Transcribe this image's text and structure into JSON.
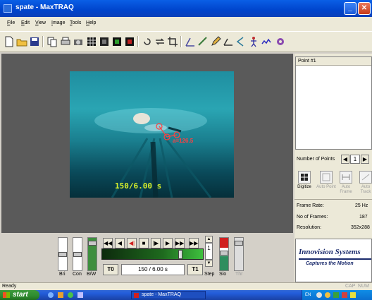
{
  "window": {
    "title": "spate - MaxTRAQ"
  },
  "menu": {
    "items": [
      "File",
      "Edit",
      "View",
      "Image",
      "Tools",
      "Help"
    ]
  },
  "video": {
    "frame_counter": "150/6.00 s",
    "point_label": "a=126.5"
  },
  "sliders": {
    "bri_label": "Bri",
    "con_label": "Con",
    "bw_label": "B/W",
    "slo_label": "Slo",
    "thr_label": "Thr"
  },
  "playback": {
    "t0_label": "T0",
    "t1_label": "T1",
    "frame_display": "150 / 6.00 s",
    "step_label": "Step",
    "step_value": "1"
  },
  "right_panel": {
    "point_list_header": "Point #1",
    "num_points_label": "Number of Points",
    "num_points_value": "1",
    "digitize_label": "Digitize",
    "auto_point_label": "Auto Point",
    "auto_frame_label": "Auto Frame",
    "auto_track_label": "Auto Track",
    "frame_rate_label": "Frame Rate:",
    "frame_rate_value": "25 Hz",
    "num_frames_label": "No of Frames:",
    "num_frames_value": "187",
    "resolution_label": "Resolution:",
    "resolution_value": "352x288",
    "logo_title": "Innovision Systems",
    "logo_tagline": "Captures the Motion"
  },
  "status": {
    "text": "Ready",
    "cap": "CAP",
    "num": "NUM"
  },
  "taskbar": {
    "start_label": "start",
    "task_item": "spate - MaxTRAQ",
    "tray_lang": "EN"
  },
  "colors": {
    "titlebar": "#0a5fe6",
    "timeline_green": "#1e6a1e",
    "frame_counter": "#d8f02a",
    "point_marker": "#ff4040"
  }
}
